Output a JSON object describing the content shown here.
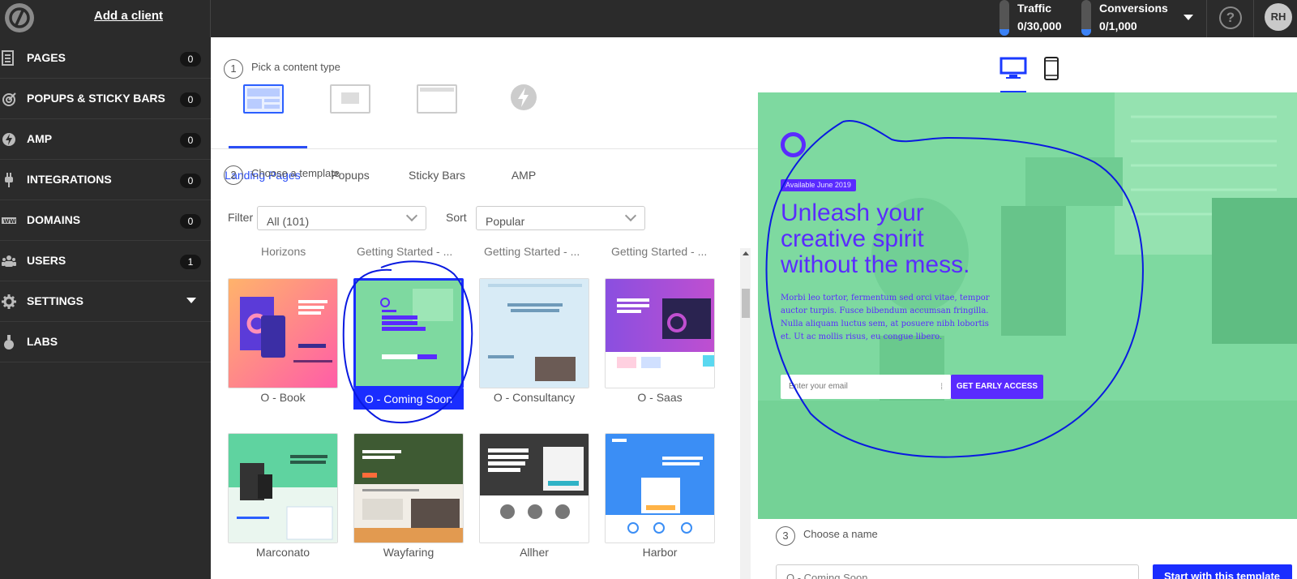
{
  "topbar": {
    "add_client": "Add a client",
    "traffic_label": "Traffic",
    "traffic_value": "0/30,000",
    "conversions_label": "Conversions",
    "conversions_value": "0/1,000",
    "help": "?",
    "avatar": "RH"
  },
  "sidebar": {
    "items": [
      {
        "label": "PAGES",
        "badge": "0",
        "icon": "pages-icon"
      },
      {
        "label": "POPUPS & STICKY BARS",
        "badge": "0",
        "icon": "target-icon"
      },
      {
        "label": "AMP",
        "badge": "0",
        "icon": "bolt-icon"
      },
      {
        "label": "INTEGRATIONS",
        "badge": "0",
        "icon": "plug-icon"
      },
      {
        "label": "DOMAINS",
        "badge": "0",
        "icon": "domain-icon"
      },
      {
        "label": "USERS",
        "badge": "1",
        "icon": "users-icon"
      },
      {
        "label": "SETTINGS",
        "badge": "",
        "icon": "gear-icon"
      },
      {
        "label": "LABS",
        "badge": "",
        "icon": "flask-icon"
      }
    ]
  },
  "steps": {
    "one": {
      "num": "1",
      "label": "Pick a content type"
    },
    "two": {
      "num": "2",
      "label": "Choose a template"
    },
    "three": {
      "num": "3",
      "label": "Choose a name"
    }
  },
  "content_types": [
    "Landing Pages",
    "Popups",
    "Sticky Bars",
    "AMP"
  ],
  "filter": {
    "label": "Filter",
    "value": "All (101)"
  },
  "sort": {
    "label": "Sort",
    "value": "Popular"
  },
  "cut_row": [
    "Horizons",
    "Getting Started - ...",
    "Getting Started - ...",
    "Getting Started - ..."
  ],
  "templates": [
    "O - Book",
    "O - Coming Soon",
    "O - Consultancy",
    "O - Saas",
    "Marconato",
    "Wayfaring",
    "Allher",
    "Harbor"
  ],
  "preview": {
    "badge": "Available June 2019",
    "headline": [
      "Unleash your",
      "creative spirit",
      "without the mess."
    ],
    "body": "Morbi leo tortor, fermentum sed orci vitae, tempor auctor turpis. Fusce bibendum accumsan fringilla. Nulla aliquam luctus sem, at posuere nibh lobortis et. Ut ac mollis risus, eu congue libero.",
    "email_placeholder": "Enter your email",
    "cta": "GET EARLY ACCESS"
  },
  "name_input_value": "O - Coming Soon",
  "start_button": "Start with this template",
  "colors": {
    "accent": "#1a2dff",
    "preview_bg": "#7ed9a0",
    "preview_text": "#5a2bff",
    "dark": "#2b2b2b"
  }
}
